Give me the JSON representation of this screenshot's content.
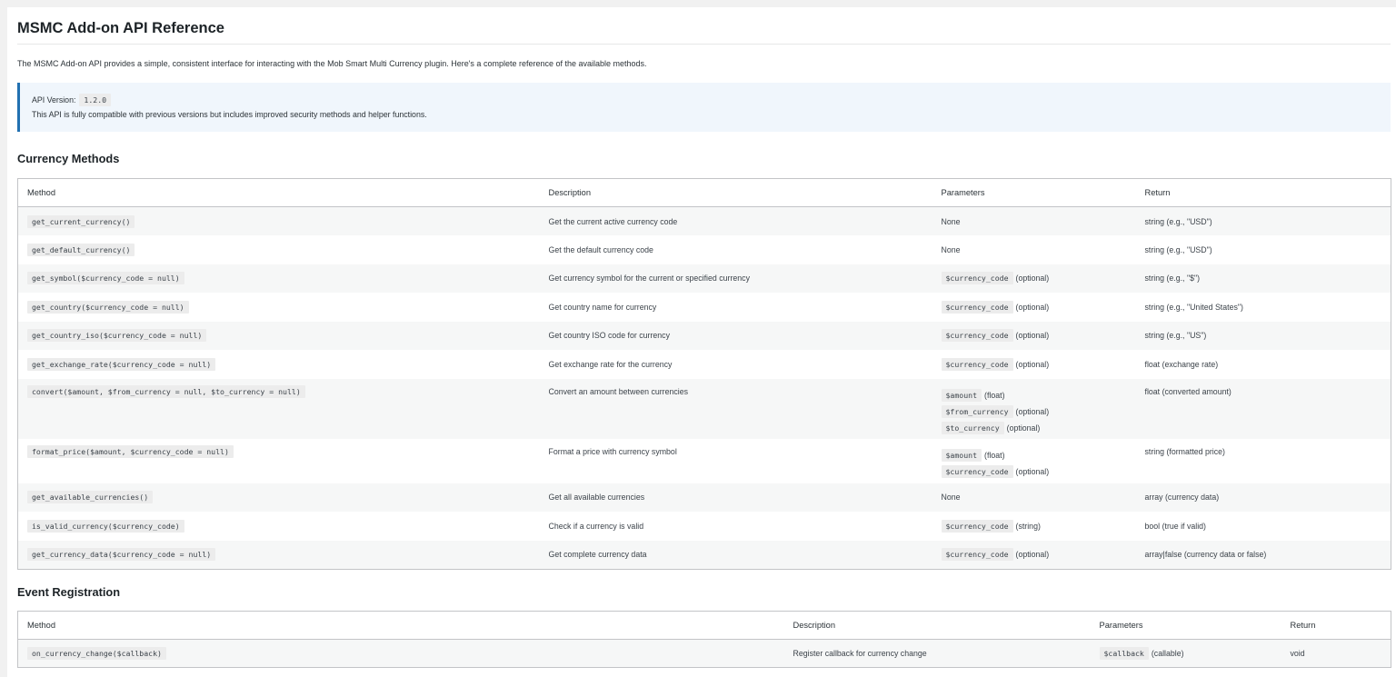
{
  "page": {
    "title": "MSMC Add-on API Reference",
    "intro": "The MSMC Add-on API provides a simple, consistent interface for interacting with the Mob Smart Multi Currency plugin. Here's a complete reference of the available methods."
  },
  "info": {
    "version_label": "API Version:",
    "version": "1.2.0",
    "note": "This API is fully compatible with previous versions but includes improved security methods and helper functions."
  },
  "currency_section": {
    "title": "Currency Methods",
    "columns": [
      "Method",
      "Description",
      "Parameters",
      "Return"
    ],
    "rows": [
      {
        "method": "get_current_currency()",
        "description": "Get the current active currency code",
        "params": [
          {
            "text": "None"
          }
        ],
        "return": "string (e.g., \"USD\")"
      },
      {
        "method": "get_default_currency()",
        "description": "Get the default currency code",
        "params": [
          {
            "text": "None"
          }
        ],
        "return": "string (e.g., \"USD\")"
      },
      {
        "method": "get_symbol($currency_code = null)",
        "description": "Get currency symbol for the current or specified currency",
        "params": [
          {
            "code": "$currency_code",
            "text": "(optional)"
          }
        ],
        "return": "string (e.g., \"$\")"
      },
      {
        "method": "get_country($currency_code = null)",
        "description": "Get country name for currency",
        "params": [
          {
            "code": "$currency_code",
            "text": "(optional)"
          }
        ],
        "return": "string (e.g., \"United States\")"
      },
      {
        "method": "get_country_iso($currency_code = null)",
        "description": "Get country ISO code for currency",
        "params": [
          {
            "code": "$currency_code",
            "text": "(optional)"
          }
        ],
        "return": "string (e.g., \"US\")"
      },
      {
        "method": "get_exchange_rate($currency_code = null)",
        "description": "Get exchange rate for the currency",
        "params": [
          {
            "code": "$currency_code",
            "text": "(optional)"
          }
        ],
        "return": "float (exchange rate)"
      },
      {
        "method": "convert($amount, $from_currency = null, $to_currency = null)",
        "description": "Convert an amount between currencies",
        "params": [
          {
            "code": "$amount",
            "text": "(float)"
          },
          {
            "code": "$from_currency",
            "text": "(optional)"
          },
          {
            "code": "$to_currency",
            "text": "(optional)"
          }
        ],
        "return": "float (converted amount)"
      },
      {
        "method": "format_price($amount, $currency_code = null)",
        "description": "Format a price with currency symbol",
        "params": [
          {
            "code": "$amount",
            "text": "(float)"
          },
          {
            "code": "$currency_code",
            "text": "(optional)"
          }
        ],
        "return": "string (formatted price)"
      },
      {
        "method": "get_available_currencies()",
        "description": "Get all available currencies",
        "params": [
          {
            "text": "None"
          }
        ],
        "return": "array (currency data)"
      },
      {
        "method": "is_valid_currency($currency_code)",
        "description": "Check if a currency is valid",
        "params": [
          {
            "code": "$currency_code",
            "text": "(string)"
          }
        ],
        "return": "bool (true if valid)"
      },
      {
        "method": "get_currency_data($currency_code = null)",
        "description": "Get complete currency data",
        "params": [
          {
            "code": "$currency_code",
            "text": "(optional)"
          }
        ],
        "return": "array|false (currency data or false)"
      }
    ]
  },
  "event_section": {
    "title": "Event Registration",
    "columns": [
      "Method",
      "Description",
      "Parameters",
      "Return"
    ],
    "rows": [
      {
        "method": "on_currency_change($callback)",
        "description": "Register callback for currency change",
        "params": [
          {
            "code": "$callback",
            "text": "(callable)"
          }
        ],
        "return": "void"
      }
    ]
  }
}
